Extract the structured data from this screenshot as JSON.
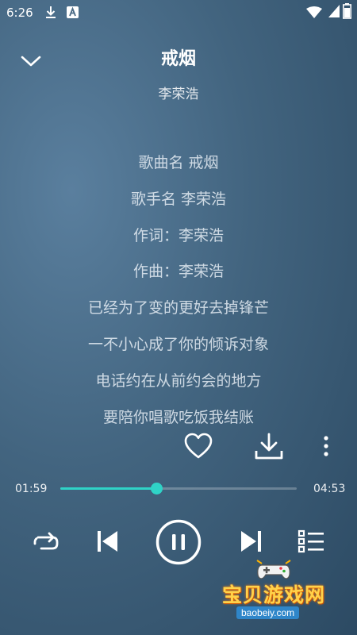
{
  "status_bar": {
    "time": "6:26",
    "icons": [
      "download-icon",
      "a-letter-icon",
      "wifi-icon",
      "battery-icon"
    ]
  },
  "player": {
    "title": "戒烟",
    "artist": "李荣浩",
    "lyrics": [
      "歌曲名 戒烟",
      "歌手名 李荣浩",
      "作词：李荣浩",
      "作曲：李荣浩",
      "已经为了变的更好去掉锋芒",
      "一不小心成了你的倾诉对象",
      "电话约在从前约会的地方",
      "要陪你唱歌吃饭我结账"
    ],
    "elapsed": "01:59",
    "duration": "04:53",
    "progress_fraction": 0.406,
    "is_playing": true
  },
  "actions": [
    "heart-icon",
    "download-icon",
    "more-vertical-icon"
  ],
  "controls": [
    "repeat-icon",
    "previous-icon",
    "pause-icon",
    "next-icon",
    "playlist-icon"
  ],
  "watermark": {
    "text": "宝贝游戏网",
    "url": "baobeiy.com"
  },
  "colors": {
    "accent": "#2fd3c7",
    "background": "#42647f"
  }
}
